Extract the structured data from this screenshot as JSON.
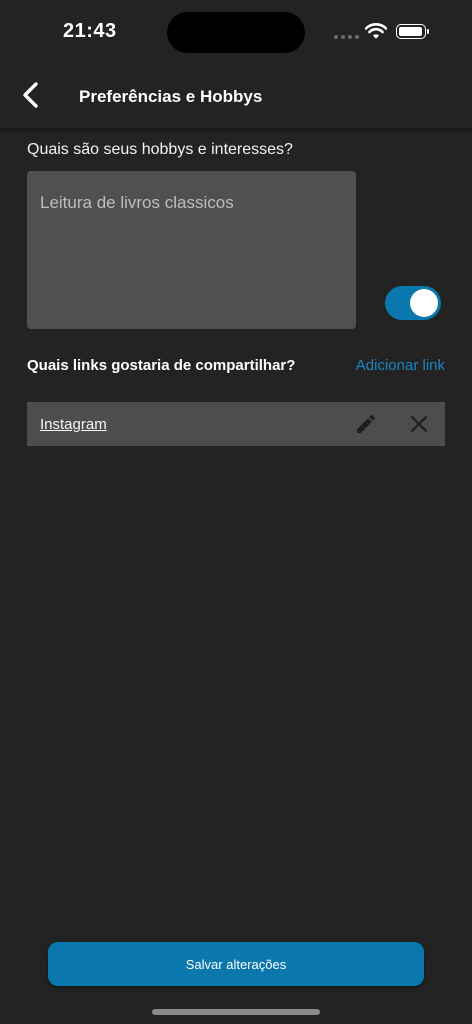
{
  "status_bar": {
    "time": "21:43",
    "icons": [
      "signal-icon",
      "wifi-icon",
      "battery-icon"
    ]
  },
  "header": {
    "title": "Preferências e Hobbys",
    "back_icon": "chevron-left-icon"
  },
  "hobbies": {
    "question": "Quais são seus hobbys e interesses?",
    "value": "Leitura de livros classicos",
    "toggle_on": true
  },
  "links": {
    "question": "Quais links gostaria de compartilhar?",
    "add_label": "Adicionar link",
    "items": [
      {
        "label": "Instagram",
        "icons": [
          "pencil-icon",
          "close-icon"
        ]
      }
    ]
  },
  "footer": {
    "save_label": "Salvar alterações"
  },
  "colors": {
    "background": "#232323",
    "accent": "#0a77ad",
    "link": "#1a85c4",
    "input_bg": "#505050",
    "row_bg": "#4d4d4d"
  }
}
